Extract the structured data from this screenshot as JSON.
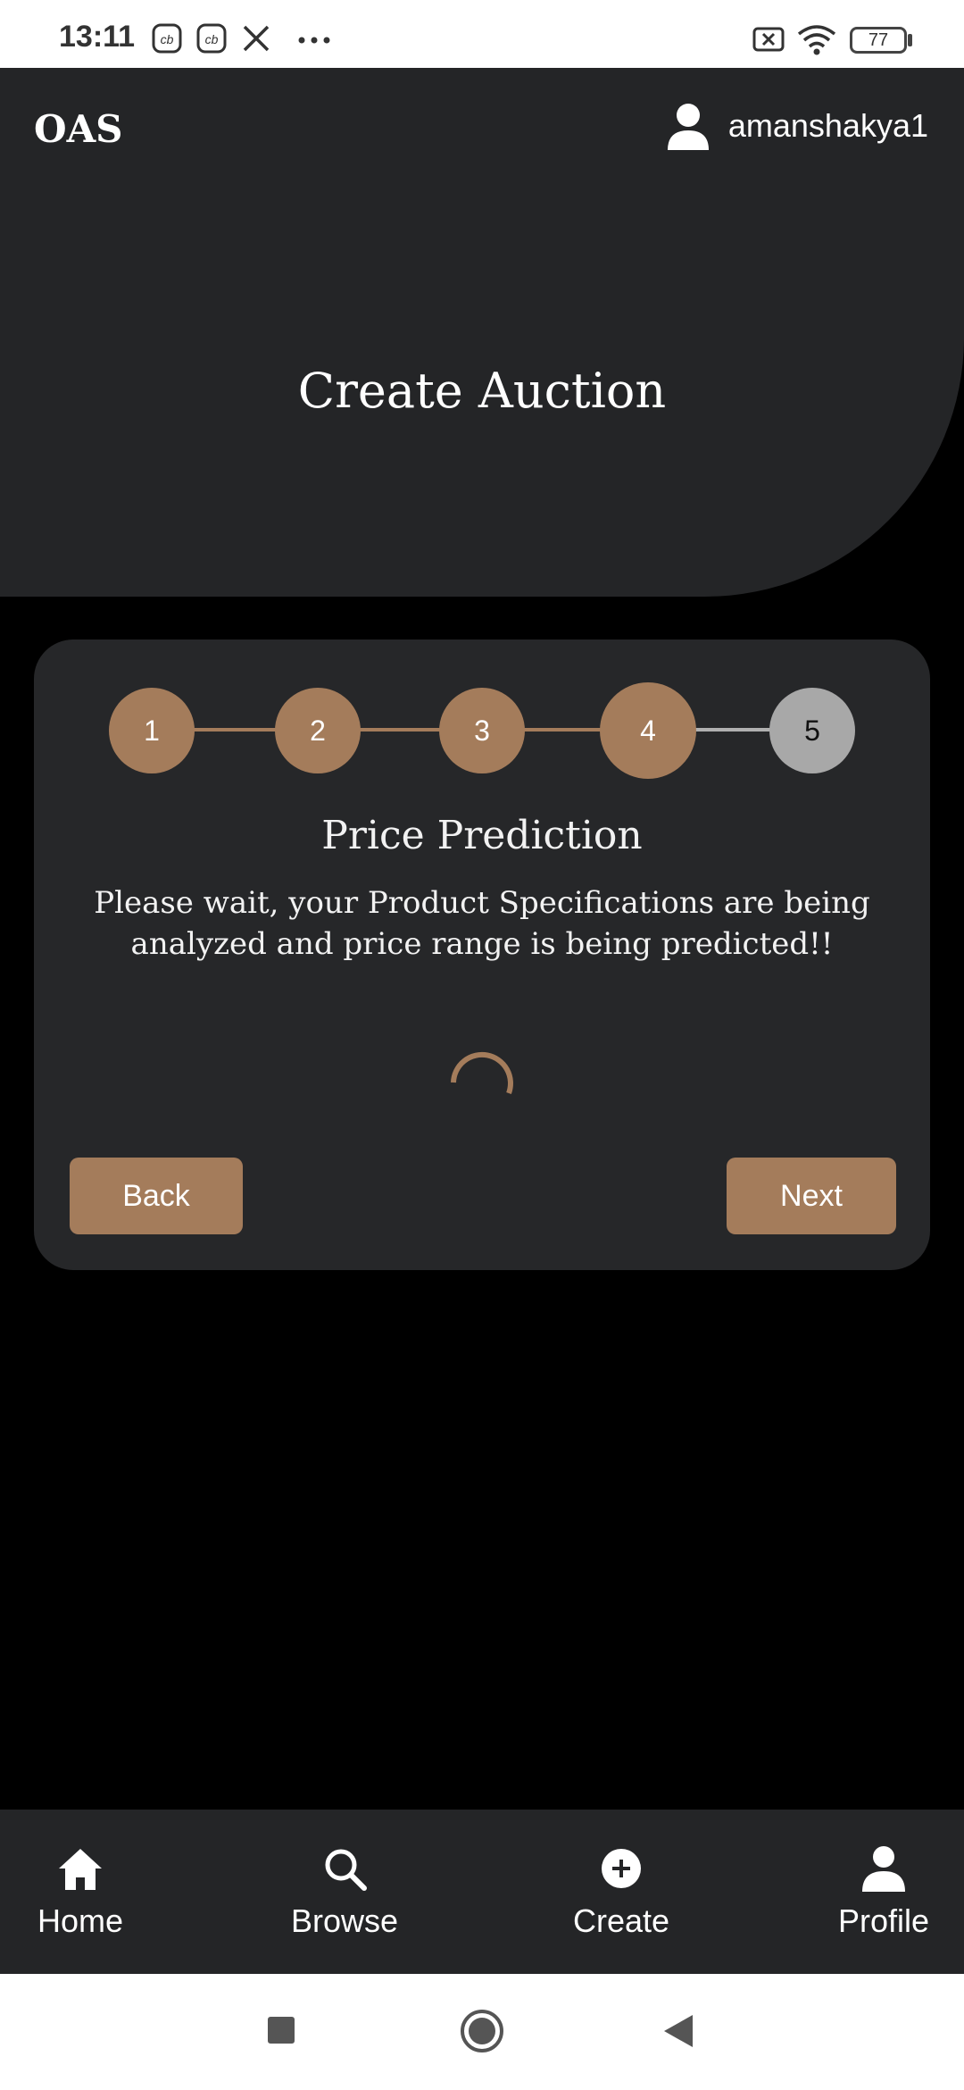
{
  "status_bar": {
    "time": "13:11",
    "battery": "77",
    "icons": [
      "cb-app-icon",
      "cb-app-icon",
      "x-app-icon",
      "more-dots-icon",
      "no-sim-icon",
      "wifi-icon",
      "battery-icon"
    ]
  },
  "header": {
    "brand": "OAS",
    "username": "amanshakya1",
    "title": "Create Auction"
  },
  "stepper": {
    "steps": [
      "1",
      "2",
      "3",
      "4",
      "5"
    ],
    "current_step": 4,
    "colors": {
      "done": "#a47c5b",
      "pending": "#a8a8a8",
      "line_done": "#a47c5b",
      "line_pending": "#b0b0b0"
    }
  },
  "section": {
    "title": "Price Prediction",
    "description": "Please wait, your Product Specifications are being analyzed and price range is being predicted!!"
  },
  "actions": {
    "back_label": "Back",
    "next_label": "Next"
  },
  "bottom_nav": {
    "home": "Home",
    "browse": "Browse",
    "create": "Create",
    "profile": "Profile"
  },
  "colors": {
    "accent": "#a47c5b",
    "surface": "#242527",
    "background": "#000000"
  }
}
